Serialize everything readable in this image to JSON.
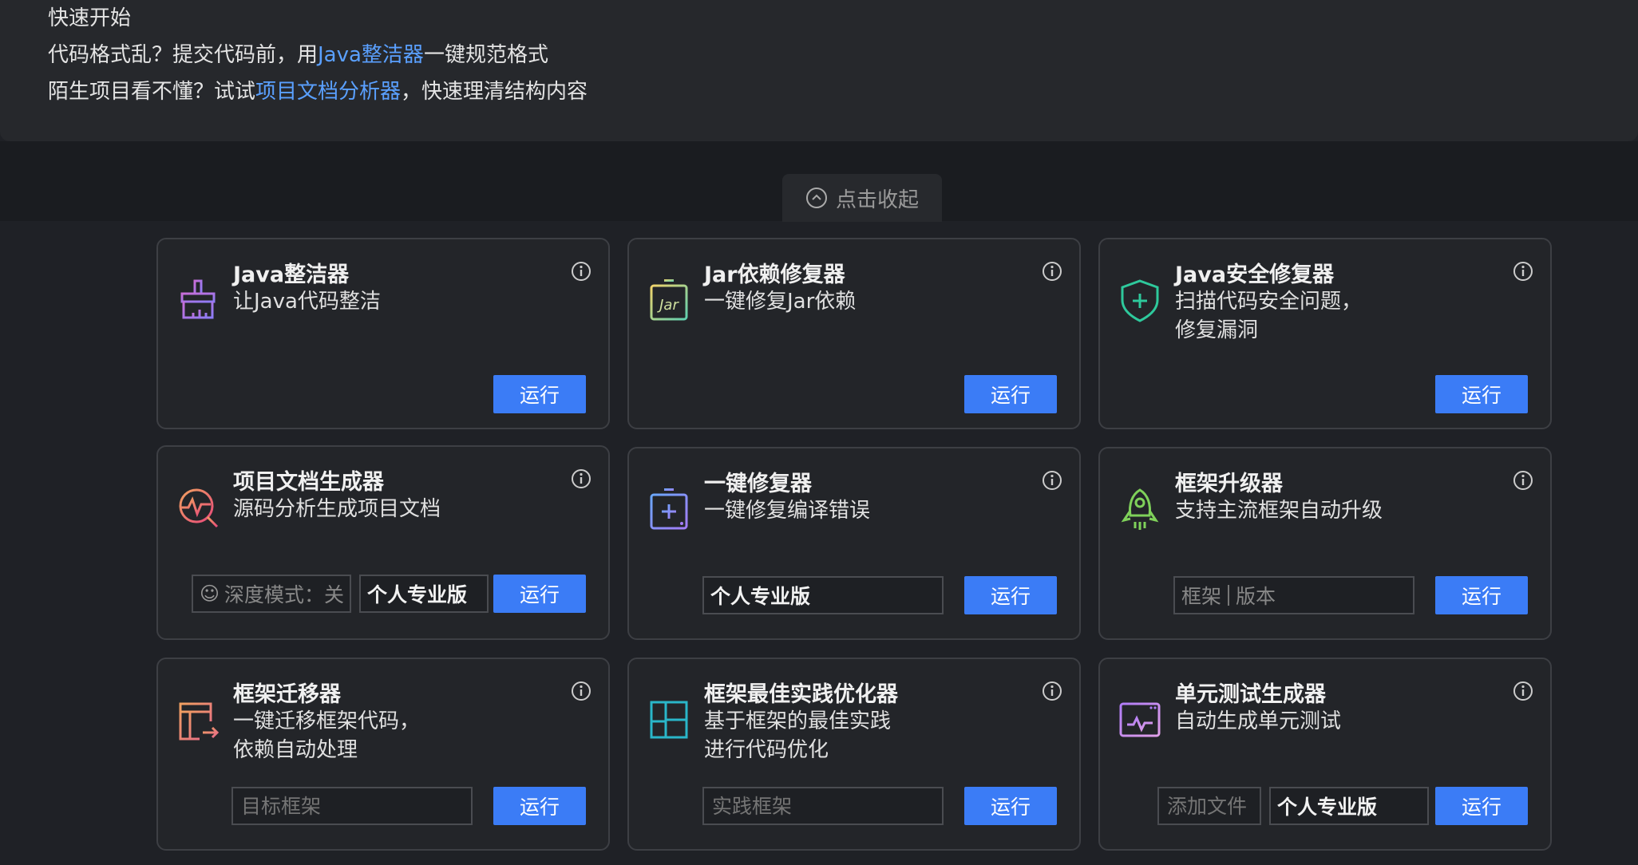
{
  "intro": {
    "heading": "快速开始",
    "line1": {
      "before": "代码格式乱？提交代码前，用",
      "link": "Java整洁器",
      "after": "一键规范格式"
    },
    "line2": {
      "before": "陌生项目看不懂？试试",
      "link": "项目文档分析器",
      "after": "，快速理清结构内容"
    }
  },
  "collapse_label": "点击收起",
  "run_label": "运行",
  "colors": {
    "accent": "#3b7cf6",
    "link": "#5aa0ff",
    "card_bg": "#232529",
    "page_bg": "#1f2126"
  },
  "cards": [
    {
      "title": "Java整洁器",
      "desc": [
        "让Java代码整洁"
      ],
      "icon": "broom-icon"
    },
    {
      "title": "Jar依赖修复器",
      "desc": [
        "一键修复Jar依赖"
      ],
      "icon": "jar-icon"
    },
    {
      "title": "Java安全修复器",
      "desc": [
        "扫描代码安全问题，",
        "修复漏洞"
      ],
      "icon": "shield-plus-icon"
    },
    {
      "title": "项目文档生成器",
      "desc": [
        "源码分析生成项目文档"
      ],
      "icon": "doc-analysis-icon",
      "fields": {
        "deep_mode": "深度模式：关",
        "edition": "个人专业版"
      }
    },
    {
      "title": "一键修复器",
      "desc": [
        "一键修复编译错误"
      ],
      "icon": "fix-box-icon",
      "fields": {
        "edition": "个人专业版"
      }
    },
    {
      "title": "框架升级器",
      "desc": [
        "支持主流框架自动升级"
      ],
      "icon": "rocket-icon",
      "fields": {
        "framework_placeholder": "框架",
        "version_placeholder": "版本"
      }
    },
    {
      "title": "框架迁移器",
      "desc": [
        "一键迁移框架代码，",
        "依赖自动处理"
      ],
      "icon": "migrate-icon",
      "fields": {
        "target_placeholder": "目标框架"
      }
    },
    {
      "title": "框架最佳实践优化器",
      "desc": [
        "基于框架的最佳实践",
        "进行代码优化"
      ],
      "icon": "layout-icon",
      "fields": {
        "practice_placeholder": "实践框架"
      }
    },
    {
      "title": "单元测试生成器",
      "desc": [
        "自动生成单元测试"
      ],
      "icon": "test-window-icon",
      "fields": {
        "add_file_placeholder": "添加文件",
        "edition": "个人专业版"
      }
    }
  ]
}
